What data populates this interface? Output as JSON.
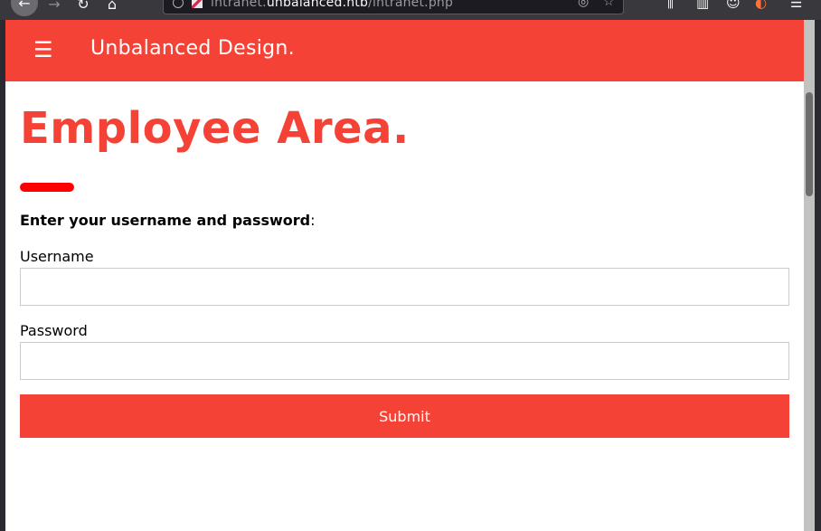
{
  "browser": {
    "url_prefix": "intranet.",
    "url_host": "unbalanced.htb",
    "url_path": "/intranet.php",
    "nav": {
      "back_icon": "←",
      "forward_icon": "→",
      "reload_icon": "↻",
      "home_icon": "⌂"
    },
    "url_icons": {
      "pocket_icon": "◎",
      "bookmark_icon": "☆"
    },
    "toolbar_icons": {
      "library_icon": "⫼",
      "sidebar_icon": "▥",
      "account_icon": "☺",
      "addon_icon": "◐",
      "menu_icon": "☰"
    }
  },
  "header": {
    "menu_icon": "☰",
    "site_title": "Unbalanced Design."
  },
  "main": {
    "heading": "Employee Area.",
    "instruction_bold": "Enter your username and password",
    "instruction_suffix": ":",
    "username": {
      "label": "Username",
      "value": ""
    },
    "password": {
      "label": "Password",
      "value": ""
    },
    "submit_label": "Submit"
  },
  "colors": {
    "accent": "#f44336",
    "heading_bar": "#ff0000"
  }
}
